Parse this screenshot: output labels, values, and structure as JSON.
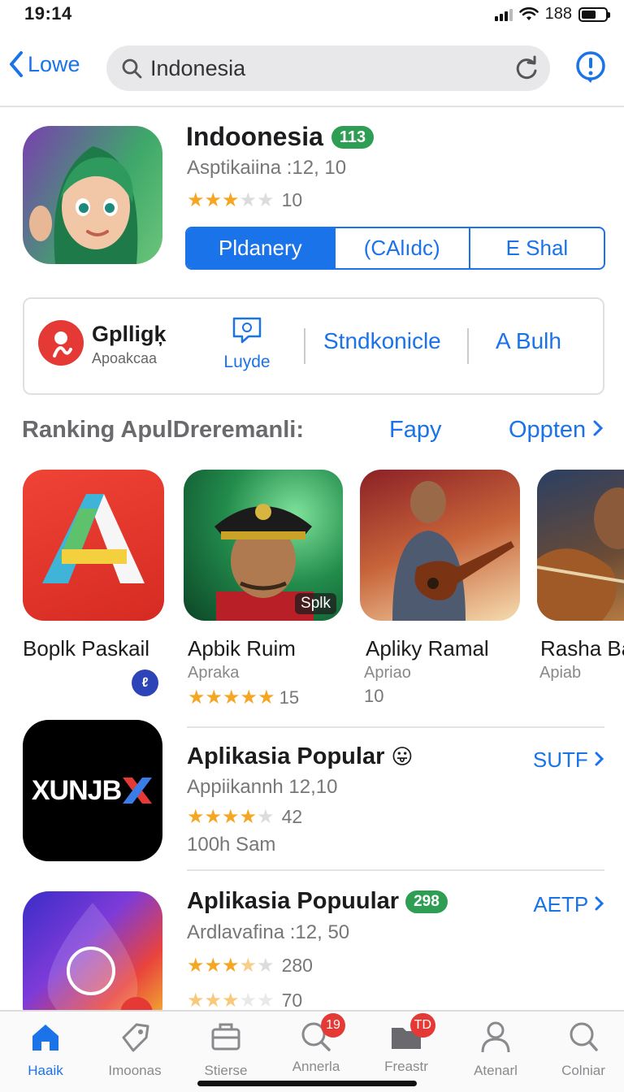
{
  "status": {
    "time": "19:14",
    "battery_text": "188"
  },
  "nav": {
    "back_label": "Lowe",
    "search_value": "Indonesia"
  },
  "hero": {
    "title": "Indoonesia",
    "badge": "113",
    "subtitle": "Asptikaiina :12, 10",
    "rating": 3,
    "rating_count": "10",
    "segments": [
      "Pldanery",
      "(CAlıdc)",
      "E Shal"
    ]
  },
  "card": {
    "name": "Gplligķ",
    "subtitle": "Apoakcaa",
    "action1": "Luyde",
    "action2": "Stndkonicle",
    "action3": "A Bulh"
  },
  "section": {
    "title": "Ranking ApulDreremanli:",
    "link1": "Fapy",
    "link2": "Oppten"
  },
  "ranking": [
    {
      "name": "Boplk Paskail"
    },
    {
      "name": "Apbik Ruim",
      "subtitle": "Apraka",
      "rating": 5,
      "count": "15",
      "label": "Splk"
    },
    {
      "name": "Apliky Ramal",
      "subtitle": "Apriao",
      "count": "10"
    },
    {
      "name": "Rasha Ba",
      "subtitle": "Apiab"
    }
  ],
  "list": [
    {
      "icon_text": "XUNJB",
      "title": "Aplikasia Popular",
      "emoji": "😛",
      "subtitle": "Appiikannh  12,10",
      "rating": 4.5,
      "count": "42",
      "extra": "100h Sam",
      "link": "SUTF"
    },
    {
      "title": "Aplikasia Popuular",
      "badge": "298",
      "subtitle": "Ardlavafina :12, 50",
      "rating": 3.5,
      "count": "280",
      "rating2": 3,
      "count2": "70",
      "link": "AETP"
    }
  ],
  "tabs": [
    {
      "label": "Haaik",
      "icon": "home-icon",
      "active": true
    },
    {
      "label": "Imoonas",
      "icon": "tag-icon"
    },
    {
      "label": "Stierse",
      "icon": "briefcase-icon"
    },
    {
      "label": "Annerla",
      "icon": "search-icon",
      "badge": "19"
    },
    {
      "label": "Freastr",
      "icon": "folder-icon",
      "badge": "TD"
    },
    {
      "label": "Atenarl",
      "icon": "person-icon"
    },
    {
      "label": "Colniar",
      "icon": "magnifier-icon"
    }
  ],
  "colors": {
    "accent": "#1a73e8",
    "badge_green": "#2f9e55",
    "star": "#f5a623",
    "notif": "#e53935"
  }
}
